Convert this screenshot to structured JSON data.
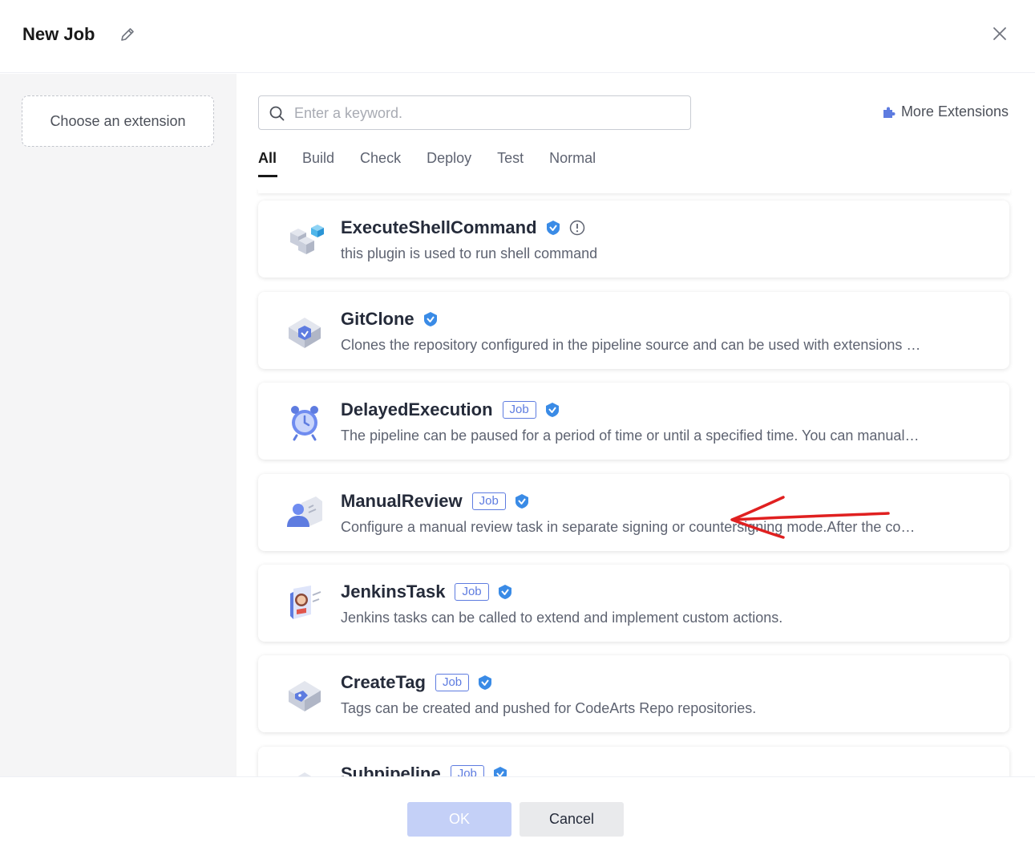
{
  "header": {
    "title": "New Job"
  },
  "left": {
    "choose_label": "Choose an extension"
  },
  "search": {
    "placeholder": "Enter a keyword."
  },
  "more_extensions": "More Extensions",
  "tabs": [
    {
      "label": "All",
      "active": true
    },
    {
      "label": "Build"
    },
    {
      "label": "Check"
    },
    {
      "label": "Deploy"
    },
    {
      "label": "Test"
    },
    {
      "label": "Normal"
    }
  ],
  "extensions": [
    {
      "name": "ExecuteShellCommand",
      "tag": "",
      "description": "this plugin is used to run shell command"
    },
    {
      "name": "GitClone",
      "tag": "",
      "description": "Clones the repository configured in the pipeline source and can be used with extensions …"
    },
    {
      "name": "DelayedExecution",
      "tag": "Job",
      "description": "The pipeline can be paused for a period of time or until a specified time. You can manual…"
    },
    {
      "name": "ManualReview",
      "tag": "Job",
      "description": "Configure a manual review task in separate signing or countersigning mode.After the co…"
    },
    {
      "name": "JenkinsTask",
      "tag": "Job",
      "description": "Jenkins tasks can be called to extend and implement custom actions."
    },
    {
      "name": "CreateTag",
      "tag": "Job",
      "description": "Tags can be created and pushed for CodeArts Repo repositories."
    },
    {
      "name": "Subpipeline",
      "tag": "Job",
      "description": ""
    }
  ],
  "footer": {
    "ok_label": "OK",
    "cancel_label": "Cancel"
  },
  "colors": {
    "accent": "#5e7ce0",
    "annotation": "#e02020",
    "verified": "#3a8be6"
  }
}
